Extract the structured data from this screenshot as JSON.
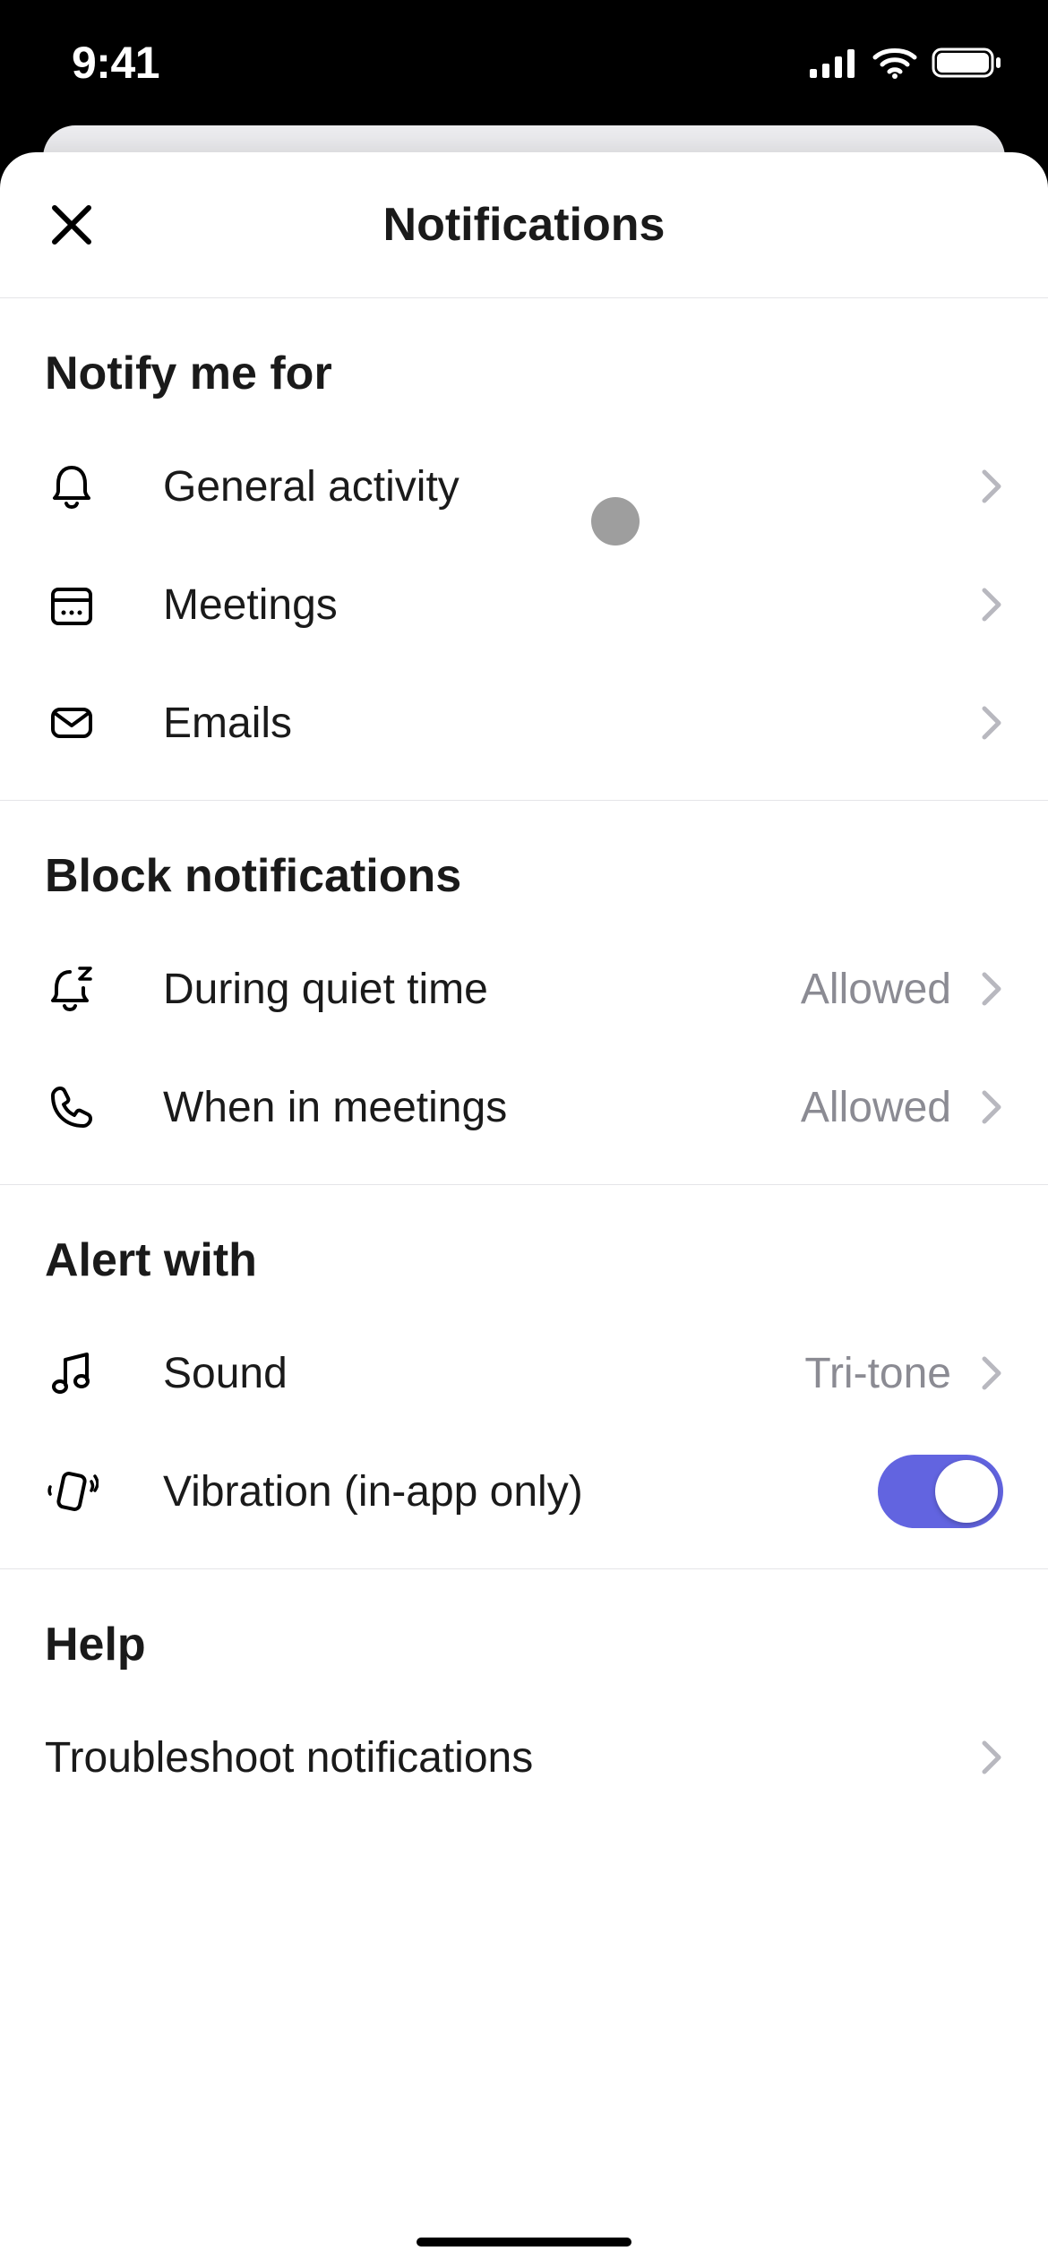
{
  "status": {
    "time": "9:41"
  },
  "header": {
    "title": "Notifications"
  },
  "sections": {
    "notify": {
      "title": "Notify me for",
      "general": "General activity",
      "meetings": "Meetings",
      "emails": "Emails"
    },
    "block": {
      "title": "Block notifications",
      "quiet": {
        "label": "During quiet time",
        "value": "Allowed"
      },
      "in_meetings": {
        "label": "When in meetings",
        "value": "Allowed"
      }
    },
    "alert": {
      "title": "Alert with",
      "sound": {
        "label": "Sound",
        "value": "Tri-tone"
      },
      "vibration": {
        "label": "Vibration (in-app only)",
        "on": true
      }
    },
    "help": {
      "title": "Help",
      "troubleshoot": "Troubleshoot notifications"
    }
  }
}
